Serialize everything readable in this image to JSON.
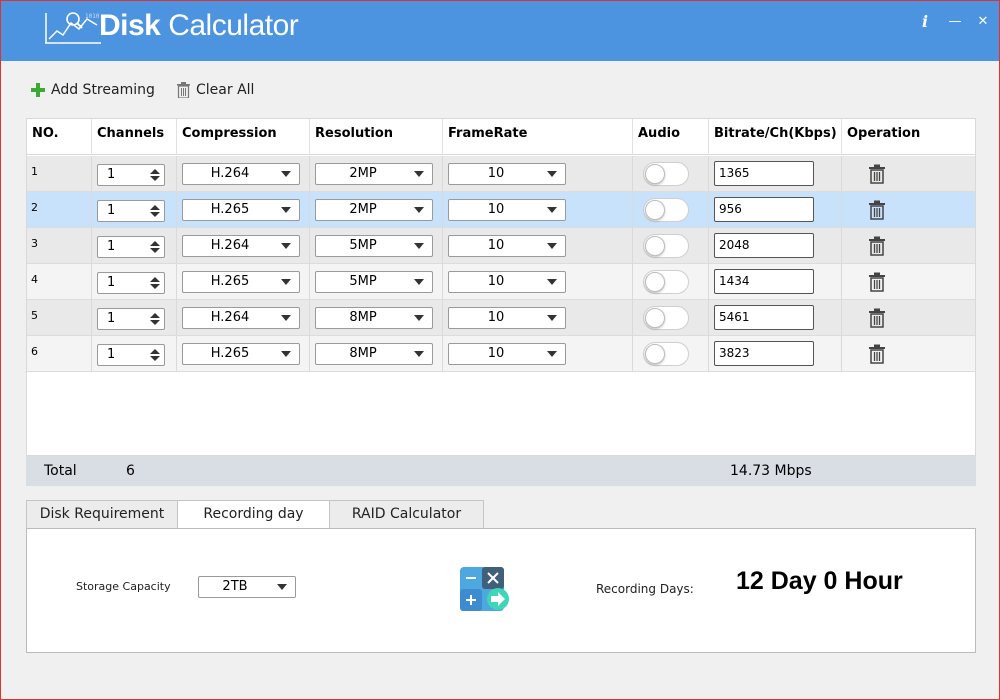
{
  "app": {
    "title_bold": "Disk",
    "title_rest": " Calculator",
    "info_label": "i",
    "minimize_label": "—",
    "close_label": "✕"
  },
  "toolbar": {
    "add_label": "Add Streaming",
    "clear_label": "Clear All"
  },
  "table": {
    "headers": [
      "NO.",
      "Channels",
      "Compression",
      "Resolution",
      "FrameRate",
      "Audio",
      "Bitrate/Ch(Kbps)",
      "Operation"
    ],
    "rows": [
      {
        "no": "1",
        "channels": "1",
        "compression": "H.264",
        "resolution": "2MP",
        "framerate": "10",
        "audio": false,
        "bitrate": "1365"
      },
      {
        "no": "2",
        "channels": "1",
        "compression": "H.265",
        "resolution": "2MP",
        "framerate": "10",
        "audio": false,
        "bitrate": "956"
      },
      {
        "no": "3",
        "channels": "1",
        "compression": "H.264",
        "resolution": "5MP",
        "framerate": "10",
        "audio": false,
        "bitrate": "2048"
      },
      {
        "no": "4",
        "channels": "1",
        "compression": "H.265",
        "resolution": "5MP",
        "framerate": "10",
        "audio": false,
        "bitrate": "1434"
      },
      {
        "no": "5",
        "channels": "1",
        "compression": "H.264",
        "resolution": "8MP",
        "framerate": "10",
        "audio": false,
        "bitrate": "5461"
      },
      {
        "no": "6",
        "channels": "1",
        "compression": "H.265",
        "resolution": "8MP",
        "framerate": "10",
        "audio": false,
        "bitrate": "3823"
      }
    ],
    "selected_row": "2"
  },
  "totals": {
    "label": "Total",
    "channels": "6",
    "bitrate": "14.73 Mbps"
  },
  "tabs": [
    {
      "label": "Disk Requirement",
      "active": false
    },
    {
      "label": "Recording day",
      "active": true
    },
    {
      "label": "RAID Calculator",
      "active": false
    }
  ],
  "panel": {
    "storage_label": "Storage Capacity",
    "storage_value": "2TB",
    "recording_label": "Recording Days:",
    "recording_value": "12 Day 0 Hour"
  },
  "colors": {
    "titlebar": "#4c93e0",
    "selected_row": "#c9e2fb",
    "add_icon": "#3aaa35"
  },
  "icons": {
    "logo": "chart-logo-icon",
    "add": "plus-icon",
    "clear": "trash-icon",
    "calculator": "calculator-icon"
  }
}
